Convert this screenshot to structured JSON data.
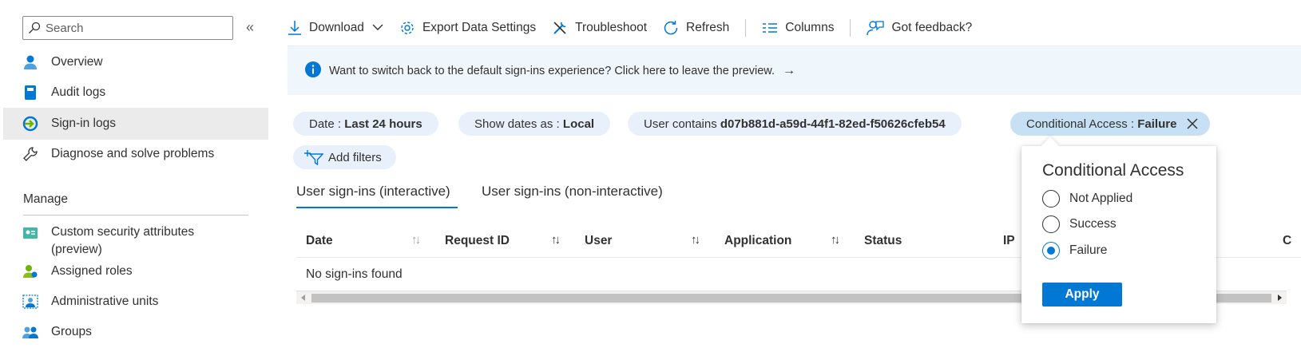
{
  "colors": {
    "accent": "#0078d4",
    "pill_bg": "#e8f1fb",
    "pill_active_bg": "#c7e0f4",
    "banner_bg": "#eff6fc",
    "selected_nav_bg": "#ebebeb"
  },
  "sidebar": {
    "search_placeholder": "Search",
    "collapse_glyph": "«",
    "items": [
      {
        "label": "Overview",
        "icon": "user-icon"
      },
      {
        "label": "Audit logs",
        "icon": "book-icon"
      },
      {
        "label": "Sign-in logs",
        "icon": "sign-in-icon",
        "selected": true
      },
      {
        "label": "Diagnose and solve problems",
        "icon": "wrench-icon"
      }
    ],
    "manage_heading": "Manage",
    "manage_items": [
      {
        "label_line1": "Custom security attributes",
        "label_line2": "(preview)",
        "icon": "attributes-icon"
      },
      {
        "label": "Assigned roles",
        "icon": "roles-icon"
      },
      {
        "label": "Administrative units",
        "icon": "admin-units-icon"
      },
      {
        "label": "Groups",
        "icon": "groups-icon"
      }
    ]
  },
  "toolbar": {
    "download": "Download",
    "export": "Export Data Settings",
    "troubleshoot": "Troubleshoot",
    "refresh": "Refresh",
    "columns": "Columns",
    "feedback": "Got feedback?"
  },
  "banner": {
    "text": "Want to switch back to the default sign-ins experience? Click here to leave the preview.",
    "arrow": "→"
  },
  "filters": [
    {
      "label": "Date : ",
      "value": "Last 24 hours"
    },
    {
      "label": "Show dates as : ",
      "value": "Local"
    },
    {
      "label": "User contains ",
      "value": "d07b881d-a59d-44f1-82ed-f50626cfeb54"
    },
    {
      "label": "Conditional Access : ",
      "value": "Failure"
    }
  ],
  "add_filters": "Add filters",
  "tabs": [
    {
      "label": "User sign-ins (interactive)",
      "active": true
    },
    {
      "label": "User sign-ins (non-interactive)",
      "active": false
    }
  ],
  "table": {
    "columns": [
      "Date",
      "Request ID",
      "User",
      "Application",
      "Status",
      "IP",
      "C"
    ],
    "sort_glyph": "↑↓",
    "empty_message": "No sign-ins found"
  },
  "popup": {
    "title": "Conditional Access",
    "options": [
      {
        "label": "Not Applied",
        "checked": false
      },
      {
        "label": "Success",
        "checked": false
      },
      {
        "label": "Failure",
        "checked": true
      }
    ],
    "apply_label": "Apply"
  }
}
